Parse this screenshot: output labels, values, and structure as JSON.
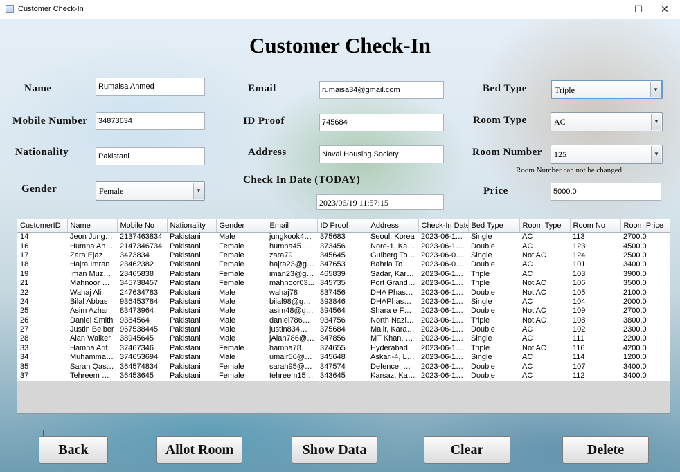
{
  "window": {
    "title": "Customer Check-In",
    "minimize": "—",
    "maximize": "☐",
    "close": "✕"
  },
  "heading": "Customer Check-In",
  "labels": {
    "name": "Name",
    "mobile": "Mobile Number",
    "nationality": "Nationality",
    "gender": "Gender",
    "email": "Email",
    "id_proof": "ID Proof",
    "address": "Address",
    "checkin_date": "Check In Date (TODAY)",
    "bed_type": "Bed Type",
    "room_type": "Room Type",
    "room_number": "Room Number",
    "room_number_note": "Room Number can not be changed",
    "price": "Price"
  },
  "fields": {
    "name": "Rumaisa Ahmed",
    "mobile": "34873634",
    "nationality": "Pakistani",
    "gender": "Female",
    "email": "rumaisa34@gmail.com",
    "id_proof": "745684",
    "address": "Naval Housing Society",
    "checkin_date": "2023/06/19 11:57:15",
    "bed_type": "Triple",
    "room_type": "AC",
    "room_number": "125",
    "price": "5000.0"
  },
  "table": {
    "columns": [
      "CustomerID",
      "Name",
      "Mobile No",
      "Nationality",
      "Gender",
      "Email",
      "ID Proof",
      "Address",
      "Check-In Date",
      "Bed Type",
      "Room Type",
      "Room No",
      "Room Price"
    ],
    "rows": [
      [
        "14",
        "Jeon Jungko...",
        "2137463834",
        "Pakistani",
        "Male",
        "jungkook45...",
        "375683",
        "Seoul, Korea",
        "2023-06-11 0...",
        "Single",
        "AC",
        "113",
        "2700.0"
      ],
      [
        "16",
        "Humna Ahm...",
        "2147346734",
        "Pakistani",
        "Female",
        "humna45@g...",
        "373456",
        "Nore-1, Kara...",
        "2023-06-16 0...",
        "Double",
        "AC",
        "123",
        "4500.0"
      ],
      [
        "17",
        "Zara Ejaz",
        "3473834",
        "Pakistani",
        "Female",
        "zara79",
        "345645",
        "Gulberg Tow...",
        "2023-06-04 0...",
        "Single",
        "Not AC",
        "124",
        "2500.0"
      ],
      [
        "18",
        "Hajra Imran",
        "23462382",
        "Pakistani",
        "Female",
        "hajra23@gm...",
        "347653",
        "Bahria Town,...",
        "2023-06-08 1...",
        "Double",
        "AC",
        "101",
        "3400.0"
      ],
      [
        "19",
        "Iman Muzaffar",
        "23465838",
        "Pakistani",
        "Female",
        "iman23@gm...",
        "465839",
        "Sadar, Karac...",
        "2023-06-18 1...",
        "Triple",
        "AC",
        "103",
        "3900.0"
      ],
      [
        "21",
        "Mahnoor Mu...",
        "345738457",
        "Pakistani",
        "Female",
        "mahnoor03...",
        "345735",
        "Port Grand, ...",
        "2023-06-18 1...",
        "Triple",
        "Not AC",
        "106",
        "3500.0"
      ],
      [
        "22",
        "Wahaj Ali",
        "247634783",
        "Pakistani",
        "Male",
        "wahaj78",
        "837456",
        "DHA Phase1...",
        "2023-06-18 1...",
        "Double",
        "Not AC",
        "105",
        "2100.0"
      ],
      [
        "24",
        "Bilal Abbas",
        "936453784",
        "Pakistani",
        "Male",
        "bilal98@gmai...",
        "393846",
        "DHAPhase 8...",
        "2023-06-18 1...",
        "Single",
        "AC",
        "104",
        "2000.0"
      ],
      [
        "25",
        "Asim Azhar",
        "83473964",
        "Pakistani",
        "Male",
        "asim48@gm...",
        "394564",
        "Shara e Fais...",
        "2023-06-18 1...",
        "Double",
        "Not AC",
        "109",
        "2700.0"
      ],
      [
        "26",
        "Daniel Smith",
        "9384564",
        "Pakistani",
        "Male",
        "daniel786@g...",
        "934756",
        "North Nazim...",
        "2023-06-18 1...",
        "Triple",
        "Not AC",
        "108",
        "3800.0"
      ],
      [
        "27",
        "Justin Beiber",
        "967538445",
        "Pakistani",
        "Male",
        "justin834@g...",
        "375684",
        "Malir, Karachi",
        "2023-06-18 1...",
        "Double",
        "AC",
        "102",
        "2300.0"
      ],
      [
        "28",
        "Alan Walker",
        "38945645",
        "Pakistani",
        "Male",
        "jAlan786@g...",
        "347856",
        "MT Khan, Ka...",
        "2023-06-18 1...",
        "Single",
        "AC",
        "111",
        "2200.0"
      ],
      [
        "33",
        "Hamna Arif",
        "37467346",
        "Pakistani",
        "Female",
        "hamna78@g...",
        "374655",
        "Hyderabad",
        "2023-06-18 1...",
        "Triple",
        "Not AC",
        "116",
        "4200.0"
      ],
      [
        "34",
        "Muhammad ...",
        "374653694",
        "Pakistani",
        "Male",
        "umair56@g...",
        "345648",
        "Askari-4, Lah...",
        "2023-06-18 1...",
        "Single",
        "AC",
        "114",
        "1200.0"
      ],
      [
        "35",
        "Sarah Qasim",
        "364574834",
        "Pakistani",
        "Female",
        "sarah95@g...",
        "347574",
        "Defence, Kar...",
        "2023-06-14 0...",
        "Double",
        "AC",
        "107",
        "3400.0"
      ],
      [
        "37",
        "Tehreem Rao",
        "36453645",
        "Pakistani",
        "Female",
        "tehreem150...",
        "343645",
        "Karsaz, Kara...",
        "2023-06-15 0...",
        "Double",
        "AC",
        "112",
        "3400.0"
      ]
    ]
  },
  "buttons": {
    "back": "Back",
    "allot": "Allot Room",
    "show": "Show Data",
    "clear": "Clear",
    "delete": "Delete"
  },
  "icons": {
    "dropdown": "▼"
  }
}
